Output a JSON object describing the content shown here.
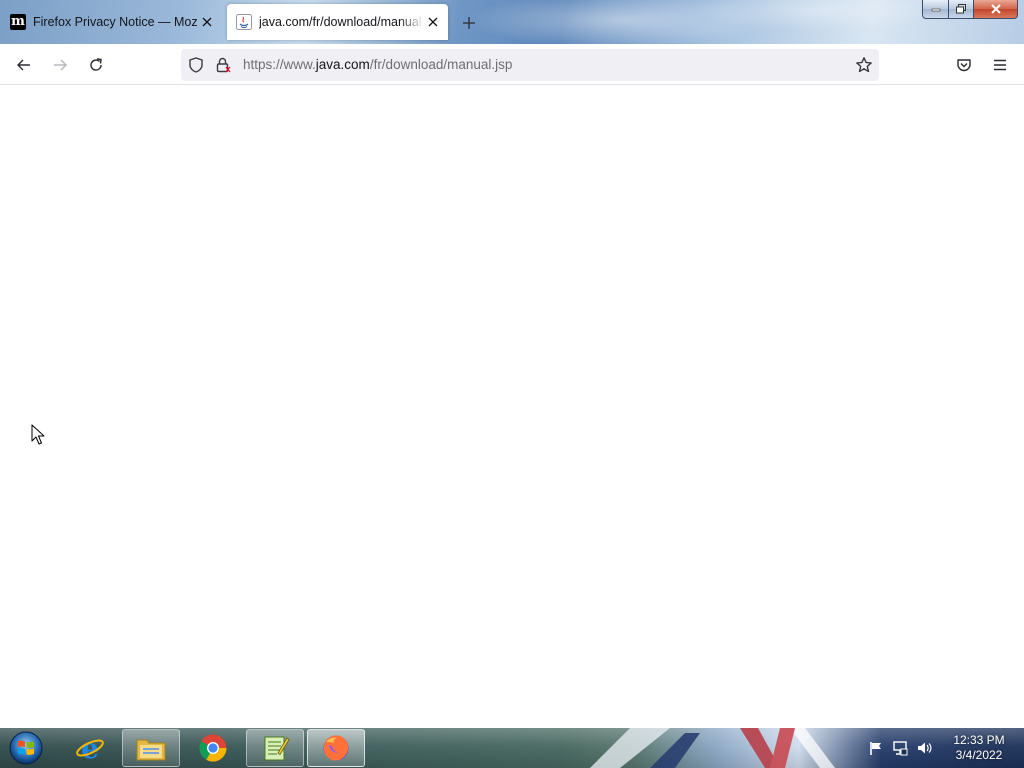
{
  "browser": {
    "tabs": [
      {
        "title": "Firefox Privacy Notice — Mozilla",
        "favicon": "mozilla-m-icon",
        "active": false
      },
      {
        "title": "java.com/fr/download/manual.jsp",
        "favicon": "java-icon",
        "active": true
      }
    ],
    "url": {
      "prefix": "https://www.",
      "domain": "java.com",
      "path": "/fr/download/manual.jsp"
    },
    "icons": {
      "back": "back-arrow-icon",
      "forward": "forward-arrow-icon",
      "reload": "reload-icon",
      "tracking": "shield-icon",
      "security": "lock-icon",
      "bookmark": "star-icon",
      "pocket": "pocket-icon",
      "menu": "hamburger-menu-icon",
      "new_tab": "plus-icon"
    }
  },
  "taskbar": {
    "items": [
      {
        "name": "start-button",
        "icon": "windows-start-icon"
      },
      {
        "name": "internet-explorer",
        "icon": "ie-icon"
      },
      {
        "name": "file-explorer",
        "icon": "folder-icon"
      },
      {
        "name": "google-chrome",
        "icon": "chrome-icon"
      },
      {
        "name": "notepad-plus-plus",
        "icon": "notepad-icon"
      },
      {
        "name": "firefox",
        "icon": "firefox-icon",
        "active": true
      }
    ],
    "clock": {
      "time": "12:33 PM",
      "date": "3/4/2022"
    }
  },
  "colors": {
    "tab_active_bg": "#ffffff",
    "urlbar_bg": "#f0f0f4",
    "text_primary": "#15141a",
    "text_secondary": "#6d6d74"
  }
}
